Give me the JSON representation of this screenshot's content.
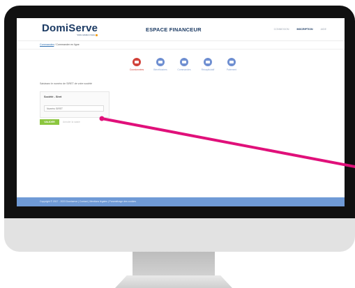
{
  "header": {
    "logo": "DomiServe",
    "logo_tagline": "Votre solution Cesu",
    "title": "ESPACE FINANCEUR",
    "nav": [
      {
        "label": "CONNEXION",
        "active": false
      },
      {
        "label": "INSCRIPTION",
        "active": true
      },
      {
        "label": "AIDE",
        "active": false
      }
    ]
  },
  "breadcrumb": {
    "home": "Commandes",
    "separator": " / ",
    "current": "Commander en ligne"
  },
  "steps": [
    {
      "label": "Coordonnées",
      "icon": "card-icon",
      "active": true
    },
    {
      "label": "Bénéficiaires",
      "icon": "people-icon",
      "active": false
    },
    {
      "label": "Commandes",
      "icon": "bag-icon",
      "active": false
    },
    {
      "label": "Récapitulatif",
      "icon": "list-icon",
      "active": false
    },
    {
      "label": "Paiement",
      "icon": "payment-icon",
      "active": false
    }
  ],
  "form": {
    "instruction": "Saisissez le numéro de SIRET de votre société",
    "field_label": "Société - Siret",
    "field_placeholder": "Numéro SIRET",
    "submit_label": "VALIDER",
    "cancel_label": "Annuler la saisie"
  },
  "footer": {
    "text": "Copyright © 2017 - 2023 Domiserve | Contact | Mentions légales | Paramétrage des cookies"
  },
  "colors": {
    "brand": "#1b3a63",
    "active_step": "#d1423a",
    "step": "#6f8fd1",
    "submit": "#8cc63f",
    "footer": "#6f9ad6",
    "pointer": "#e0107a"
  }
}
